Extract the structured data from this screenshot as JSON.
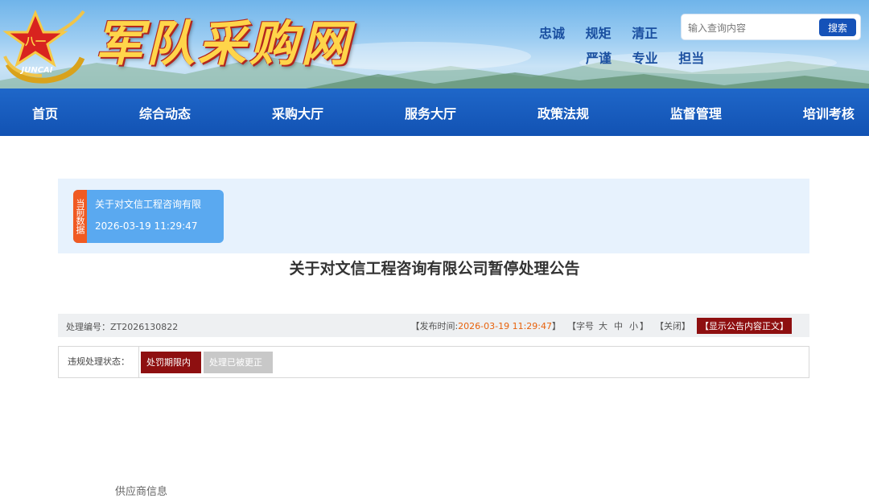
{
  "header": {
    "site_title": "军队采购网",
    "logo_text": "JUNCAI",
    "emblem_text": "八一",
    "mottos_row1": [
      "忠诚",
      "规矩",
      "清正"
    ],
    "mottos_row2": [
      "严谨",
      "专业",
      "担当"
    ],
    "search": {
      "placeholder": "输入查询内容",
      "button_label": "搜索"
    }
  },
  "nav": {
    "items": [
      "首页",
      "综合动态",
      "采购大厅",
      "服务大厅",
      "政策法规",
      "监督管理",
      "培训考核"
    ]
  },
  "current_data": {
    "tag": "当前数据",
    "title": "关于对文信工程咨询有限",
    "time": "2026-03-19 11:29:47"
  },
  "article": {
    "title": "关于对文信工程咨询有限公司暂停处理公告"
  },
  "meta": {
    "id_label": "处理编号：",
    "id_value": "ZT2026130822",
    "publish_prefix": "【发布时间:",
    "publish_time": "2026-03-19 11:29:47",
    "publish_suffix": "】",
    "fontsize_prefix": "【字号",
    "size_large": "大",
    "size_medium": "中",
    "size_small": "小",
    "fontsize_suffix": "】",
    "close_label": "【关闭】",
    "show_full_label": "【显示公告内容正文】"
  },
  "status": {
    "label": "违规处理状态：",
    "active": "处罚期限内",
    "inactive": "处理已被更正"
  },
  "bottom_fragment": "供应商信息",
  "colors": {
    "nav_blue": "#1252b3",
    "accent_red": "#8e0f10",
    "accent_orange": "#f05a22",
    "card_blue": "#5aa9f0"
  }
}
